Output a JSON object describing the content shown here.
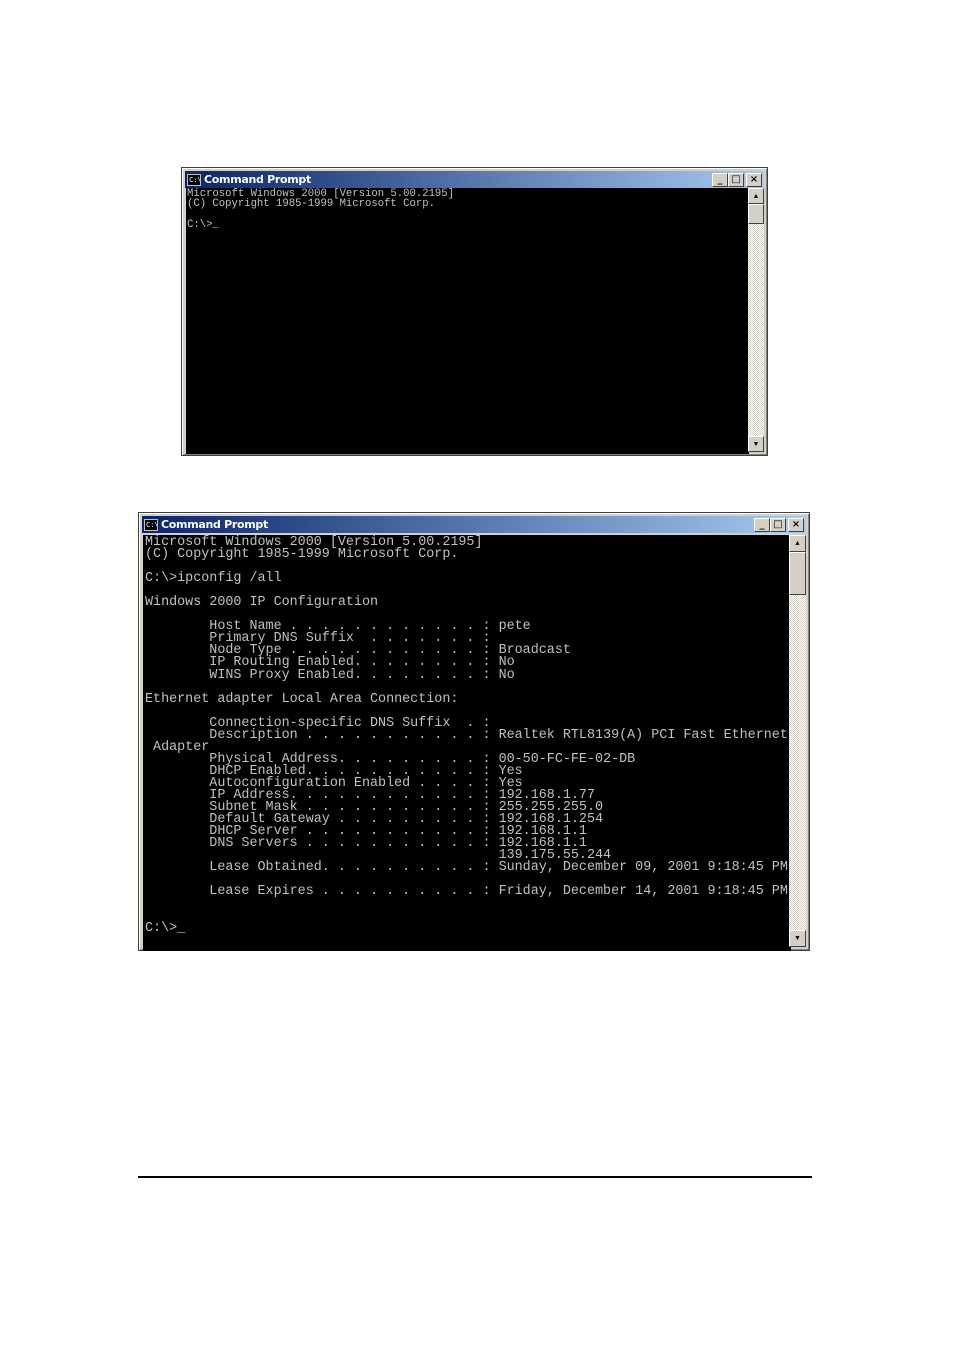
{
  "window1": {
    "title": "Command Prompt",
    "icon": "cmd-icon",
    "icon_text": "C:\\",
    "minimize_label": "_",
    "maximize_label": "□",
    "close_label": "×",
    "lines": [
      "Microsoft Windows 2000 [Version 5.00.2195]",
      "(C) Copyright 1985-1999 Microsoft Corp.",
      "",
      "C:\\>_"
    ],
    "scroll_up": "▲",
    "scroll_down": "▼"
  },
  "window2": {
    "title": "Command Prompt",
    "icon": "cmd-icon",
    "icon_text": "C:\\",
    "minimize_label": "_",
    "maximize_label": "□",
    "close_label": "×",
    "lines": [
      "Microsoft Windows 2000 [Version 5.00.2195]",
      "(C) Copyright 1985-1999 Microsoft Corp.",
      "",
      "C:\\>ipconfig /all",
      "",
      "Windows 2000 IP Configuration",
      "",
      "        Host Name . . . . . . . . . . . . : pete",
      "        Primary DNS Suffix  . . . . . . . :",
      "        Node Type . . . . . . . . . . . . : Broadcast",
      "        IP Routing Enabled. . . . . . . . : No",
      "        WINS Proxy Enabled. . . . . . . . : No",
      "",
      "Ethernet adapter Local Area Connection:",
      "",
      "        Connection-specific DNS Suffix  . :",
      "        Description . . . . . . . . . . . : Realtek RTL8139(A) PCI Fast Ethernet",
      " Adapter",
      "        Physical Address. . . . . . . . . : 00-50-FC-FE-02-DB",
      "        DHCP Enabled. . . . . . . . . . . : Yes",
      "        Autoconfiguration Enabled . . . . : Yes",
      "        IP Address. . . . . . . . . . . . : 192.168.1.77",
      "        Subnet Mask . . . . . . . . . . . : 255.255.255.0",
      "        Default Gateway . . . . . . . . . : 192.168.1.254",
      "        DHCP Server . . . . . . . . . . . : 192.168.1.1",
      "        DNS Servers . . . . . . . . . . . : 192.168.1.1",
      "                                            139.175.55.244",
      "        Lease Obtained. . . . . . . . . . : Sunday, December 09, 2001 9:18:45 PM",
      "",
      "        Lease Expires . . . . . . . . . . : Friday, December 14, 2001 9:18:45 PM",
      "",
      "",
      "C:\\>_"
    ],
    "scroll_up": "▲",
    "scroll_down": "▼"
  }
}
